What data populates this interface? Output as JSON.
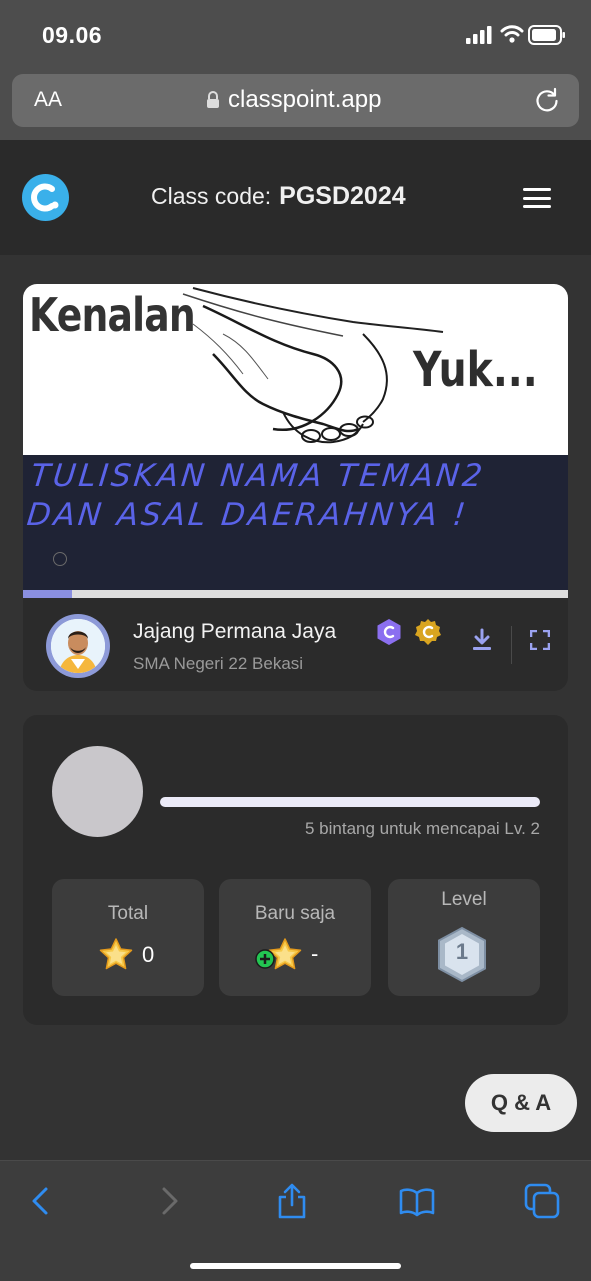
{
  "status_bar": {
    "time": "09.06",
    "icons": [
      "cellular-signal-icon",
      "wifi-icon",
      "battery-icon"
    ]
  },
  "browser": {
    "text_size_label": "AA",
    "url": "classpoint.app",
    "icons": [
      "lock-icon",
      "reload-icon"
    ]
  },
  "header": {
    "class_code_label": "Class code:",
    "class_code": "PGSD2024",
    "logo_icon": "classpoint-logo-icon",
    "menu_icon": "hamburger-menu-icon"
  },
  "slide": {
    "title_left": "Kenalan",
    "title_right": "Yuk...",
    "prompt": "TULISKAN NAMA TEMAN2 DAN ASAL DAERAHNYA !",
    "progress": 0.09
  },
  "presenter": {
    "name": "Jajang Permana Jaya",
    "school": "SMA Negeri 22 Bekasi",
    "badges": [
      "classpoint-purple-badge-icon",
      "classpoint-gold-badge-icon"
    ],
    "actions": [
      "download-icon",
      "fullscreen-icon"
    ]
  },
  "stats": {
    "next_level_text": "5 bintang untuk mencapai Lv. 2",
    "xp_progress": 0,
    "total_label": "Total",
    "total_value": "0",
    "recent_label": "Baru saja",
    "recent_value": "-",
    "level_label": "Level",
    "level_value": "1"
  },
  "qa_button": "Q & A",
  "toolbar": [
    "back-icon",
    "forward-icon",
    "share-icon",
    "bookmarks-icon",
    "tabs-icon"
  ],
  "colors": {
    "background": "#333333",
    "accent": "#5a63e8",
    "logo": "#3ab0ea",
    "badge_purple": "#8b6ff0",
    "badge_gold": "#d9a520",
    "toolbar_icon": "#2f8cf0"
  }
}
